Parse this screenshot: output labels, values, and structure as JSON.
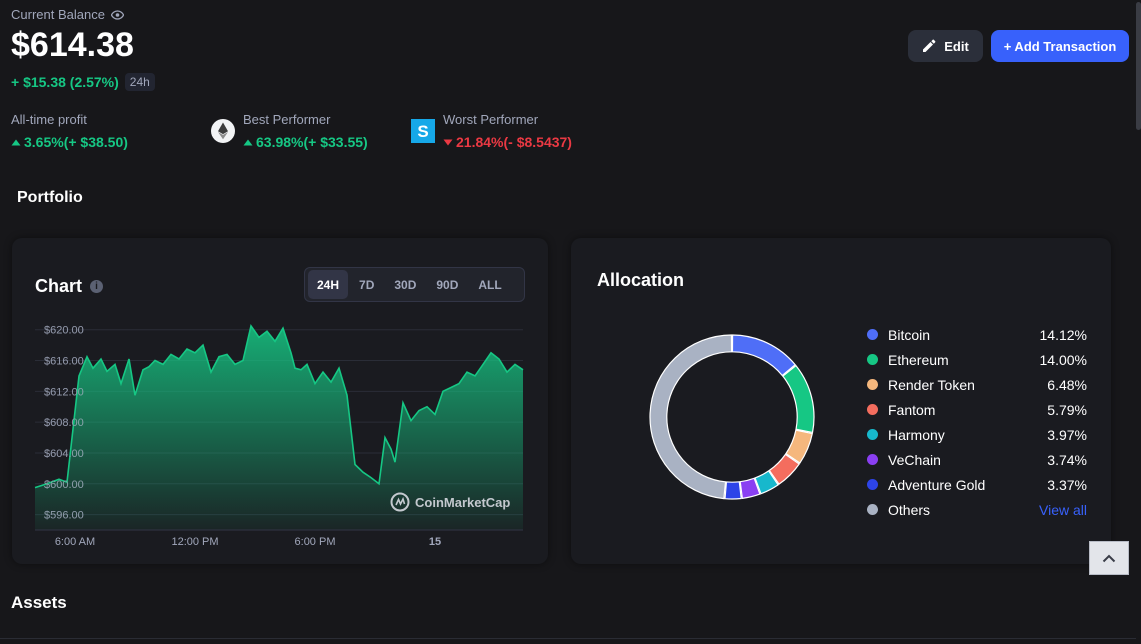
{
  "balance": {
    "label": "Current Balance",
    "value": "$614.38",
    "change": "+ $15.38 (2.57%)",
    "period": "24h"
  },
  "actions": {
    "edit_label": "Edit",
    "add_label": "+ Add Transaction"
  },
  "stats": {
    "all_time": {
      "label": "All-time profit",
      "value": "3.65%(+ $38.50)",
      "direction": "up"
    },
    "best": {
      "label": "Best Performer",
      "value": "63.98%(+ $33.55)",
      "direction": "up",
      "icon": "ethereum-logo-icon"
    },
    "worst": {
      "label": "Worst Performer",
      "value": "21.84%(- $8.5437)",
      "direction": "down",
      "icon": "sandbox-logo-icon"
    }
  },
  "portfolio_title": "Portfolio",
  "chart_card": {
    "title": "Chart",
    "tabs": [
      "24H",
      "7D",
      "30D",
      "90D",
      "ALL"
    ],
    "active_tab": "24H",
    "watermark": "CoinMarketCap"
  },
  "chart_data": {
    "type": "area",
    "title": "",
    "xlabel": "",
    "ylabel": "",
    "ylim": [
      594,
      621
    ],
    "y_ticks": [
      "$620.00",
      "$616.00",
      "$612.00",
      "$608.00",
      "$604.00",
      "$600.00",
      "$596.00"
    ],
    "x_ticks": [
      "6:00 AM",
      "12:00 PM",
      "6:00 PM",
      "15"
    ],
    "x_tick_hours": [
      6,
      12,
      18,
      24
    ],
    "x_range_hours": [
      4.0,
      28.4
    ],
    "x_hours": [
      4.0,
      4.6,
      5.2,
      5.6,
      6.2,
      6.6,
      6.9,
      7.3,
      7.6,
      8.0,
      8.3,
      8.7,
      9.0,
      9.4,
      9.7,
      10.0,
      10.4,
      10.8,
      11.2,
      11.6,
      12.0,
      12.4,
      12.8,
      13.2,
      13.6,
      14.0,
      14.4,
      14.8,
      15.2,
      15.6,
      16.0,
      16.4,
      16.8,
      17.0,
      17.3,
      17.6,
      18.0,
      18.4,
      18.8,
      19.2,
      19.6,
      20.0,
      20.4,
      20.8,
      21.2,
      21.5,
      21.8,
      22.0,
      22.4,
      22.8,
      23.2,
      23.6,
      24.0,
      24.4,
      24.8,
      25.2,
      25.6,
      26.0,
      26.4,
      26.8,
      27.2,
      27.6,
      28.0,
      28.4
    ],
    "values": [
      599.5,
      600.0,
      600.6,
      600.2,
      614.0,
      616.5,
      615.0,
      616.2,
      614.6,
      615.5,
      613.0,
      616.2,
      611.5,
      614.8,
      615.2,
      616.0,
      615.5,
      616.8,
      616.2,
      617.5,
      617.0,
      618.0,
      614.5,
      616.5,
      616.8,
      615.5,
      616.0,
      620.5,
      619.0,
      619.8,
      618.5,
      620.2,
      617.0,
      615.0,
      614.8,
      615.5,
      613.0,
      614.5,
      613.2,
      615.0,
      611.5,
      602.5,
      601.5,
      600.8,
      600.0,
      606.0,
      604.5,
      602.8,
      610.5,
      608.2,
      609.5,
      610.0,
      609.0,
      612.0,
      612.5,
      613.0,
      614.5,
      614.0,
      615.5,
      617.0,
      616.2,
      614.5,
      615.5,
      614.8
    ],
    "line_color": "#16c784",
    "grid": true
  },
  "allocation": {
    "title": "Allocation",
    "items": [
      {
        "name": "Bitcoin",
        "pct": "14.12%",
        "value": 14.12,
        "color": "#4f6ef7"
      },
      {
        "name": "Ethereum",
        "pct": "14.00%",
        "value": 14.0,
        "color": "#16c784"
      },
      {
        "name": "Render Token",
        "pct": "6.48%",
        "value": 6.48,
        "color": "#f5b77d"
      },
      {
        "name": "Fantom",
        "pct": "5.79%",
        "value": 5.79,
        "color": "#f46d5e"
      },
      {
        "name": "Harmony",
        "pct": "3.97%",
        "value": 3.97,
        "color": "#17b8cc"
      },
      {
        "name": "VeChain",
        "pct": "3.74%",
        "value": 3.74,
        "color": "#8a3ff2"
      },
      {
        "name": "Adventure Gold",
        "pct": "3.37%",
        "value": 3.37,
        "color": "#2d44e8"
      },
      {
        "name": "Others",
        "pct": "",
        "value": 48.53,
        "color": "#a9b2c3"
      }
    ],
    "view_all": "View all"
  },
  "assets_title": "Assets"
}
